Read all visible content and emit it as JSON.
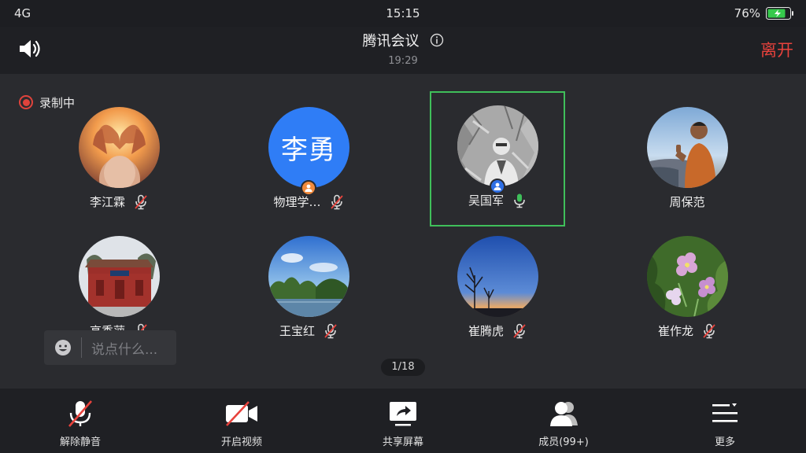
{
  "status_bar": {
    "network": "4G",
    "time": "15:15",
    "battery": "76%"
  },
  "header": {
    "title": "腾讯会议",
    "duration": "19:29",
    "leave_label": "离开"
  },
  "recording": {
    "label": "录制中"
  },
  "participants": [
    {
      "name": "李江霖",
      "mic": "muted",
      "avatar": "hands-heart-photo"
    },
    {
      "name": "物理学…",
      "mic": "muted",
      "avatar_text": "李勇",
      "avatar": "text-avatar",
      "badge": "host"
    },
    {
      "name": "吴国军",
      "mic": "active",
      "avatar": "person-sketch-photo",
      "badge": "host",
      "speaking": true
    },
    {
      "name": "周保范",
      "mic": "none",
      "avatar": "man-thumbs-up-photo"
    },
    {
      "name": "高秀萍",
      "mic": "muted",
      "avatar": "temple-gate-photo"
    },
    {
      "name": "王宝红",
      "mic": "muted",
      "avatar": "lake-trees-photo"
    },
    {
      "name": "崔腾虎",
      "mic": "muted",
      "avatar": "dusk-sky-photo"
    },
    {
      "name": "崔作龙",
      "mic": "muted",
      "avatar": "purple-flowers-photo"
    }
  ],
  "chat": {
    "placeholder": "说点什么..."
  },
  "pager": {
    "label": "1/18"
  },
  "toolbar": {
    "unmute": "解除静音",
    "start_video": "开启视频",
    "share_screen": "共享屏幕",
    "members": "成员(99+)",
    "more": "更多"
  },
  "colors": {
    "leave": "#e8423c",
    "active_border": "#3fbf5a",
    "recording": "#e0433c",
    "host_badge_orange": "#f08a3c",
    "host_badge_blue": "#2e6fe6",
    "text_avatar_bg": "#2f7df6"
  }
}
